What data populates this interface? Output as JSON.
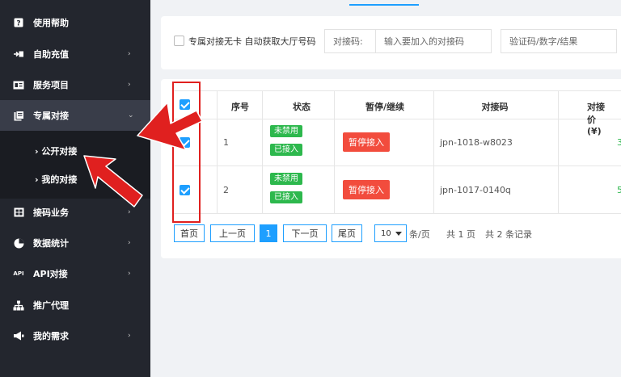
{
  "sidebar": {
    "items": [
      {
        "label": "使用帮助",
        "icon": "help-icon",
        "chevron": ""
      },
      {
        "label": "自助充值",
        "icon": "recharge-icon",
        "chevron": "›"
      },
      {
        "label": "服务项目",
        "icon": "service-icon",
        "chevron": "›"
      },
      {
        "label": "专属对接",
        "icon": "dedicated-icon",
        "chevron": "⌄"
      },
      {
        "label": "接码业务",
        "icon": "sms-code-icon",
        "chevron": "›"
      },
      {
        "label": "数据统计",
        "icon": "stats-icon",
        "chevron": "›"
      },
      {
        "label": "API对接",
        "icon": "api-icon",
        "chevron": "›"
      },
      {
        "label": "推广代理",
        "icon": "promotion-icon",
        "chevron": ""
      },
      {
        "label": "我的需求",
        "icon": "demand-icon",
        "chevron": "›"
      }
    ],
    "submenu": [
      {
        "label": "› 公开对接"
      },
      {
        "label": "› 我的对接"
      }
    ],
    "api_icon_text": "API"
  },
  "filter": {
    "auto_checkbox_label": "专属对接无卡 自动获取大厅号码",
    "code_prefix": "对接码:",
    "code_placeholder": "输入要加入的对接码",
    "captcha_placeholder": "验证码/数字/结果"
  },
  "table": {
    "headers": [
      "序号",
      "状态",
      "暂停/继续",
      "对接码",
      "对接价(¥)"
    ],
    "rows": [
      {
        "index": "1",
        "status1": "未禁用",
        "status2": "已接入",
        "action": "暂停接入",
        "code": "jpn-1018-w8023",
        "price": "3",
        "checked": true
      },
      {
        "index": "2",
        "status1": "未禁用",
        "status2": "已接入",
        "action": "暂停接入",
        "code": "jpn-1017-0140q",
        "price": "5",
        "checked": true
      }
    ],
    "header_checked": true
  },
  "pagination": {
    "first": "首页",
    "prev": "上一页",
    "current": "1",
    "next": "下一页",
    "last": "尾页",
    "page_size": "10",
    "per_page": "条/页",
    "total_pages": "共 1 页",
    "total_records": "共 2 条记录"
  },
  "colors": {
    "sidebar_bg": "#23262e",
    "accent": "#1e9fff",
    "success": "#2db84d",
    "danger": "#f24c3d",
    "annotation": "#e0201f"
  }
}
